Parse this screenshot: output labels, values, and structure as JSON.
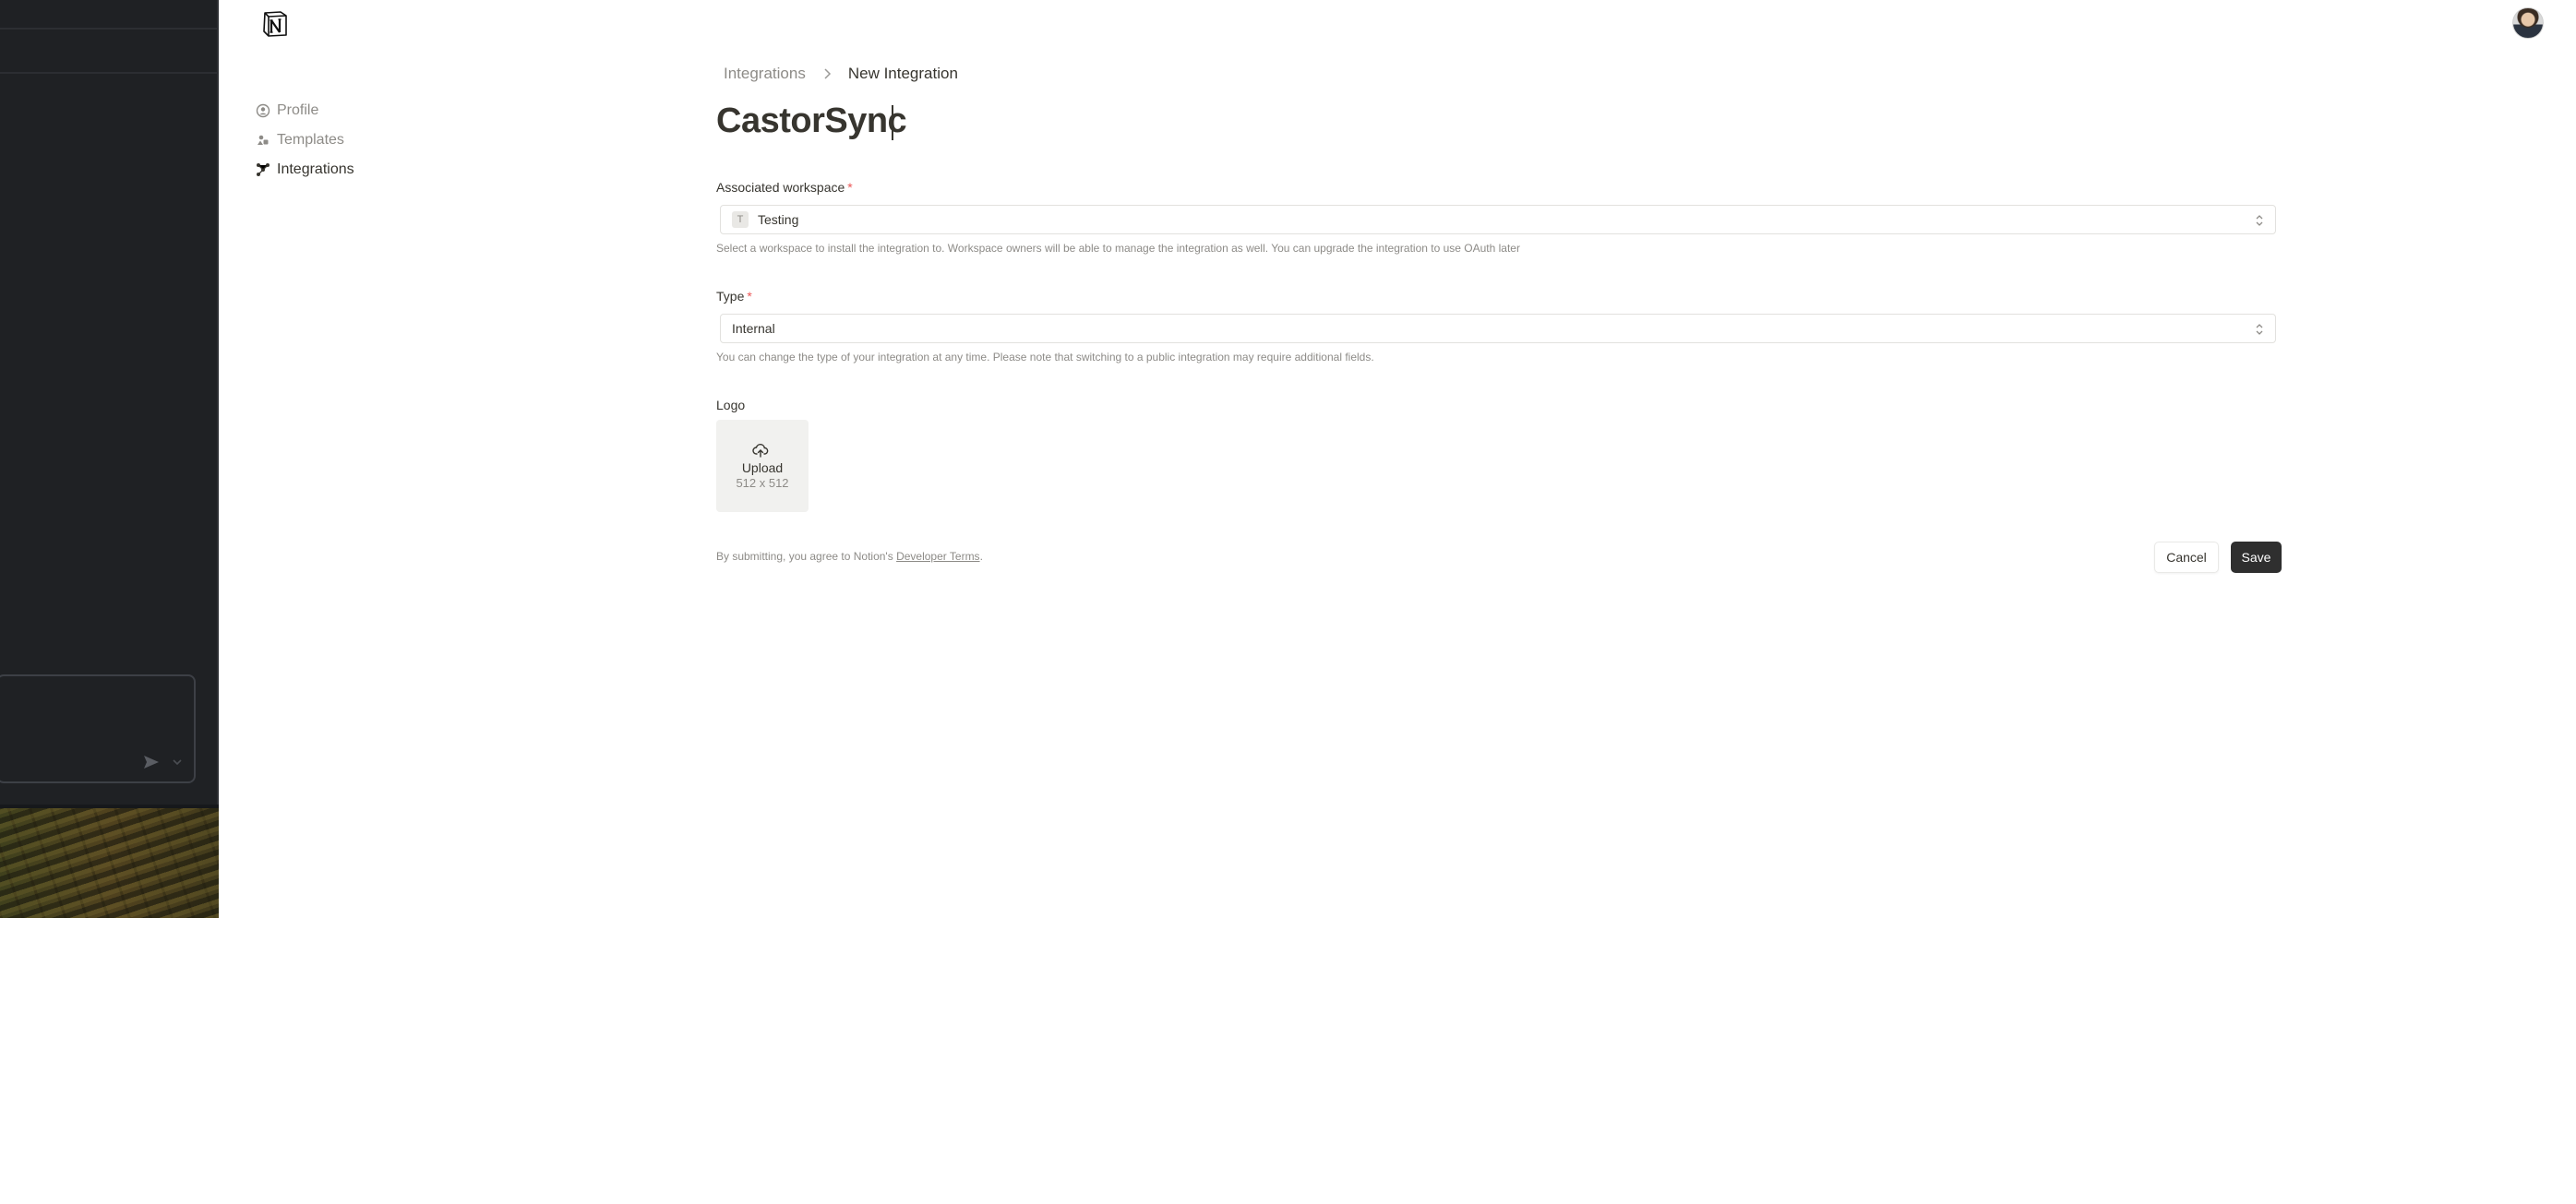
{
  "sidebar_nav": {
    "items": [
      {
        "label": "Profile",
        "icon": "profile-icon",
        "active": false
      },
      {
        "label": "Templates",
        "icon": "templates-icon",
        "active": false
      },
      {
        "label": "Integrations",
        "icon": "integrations-icon",
        "active": true
      }
    ]
  },
  "breadcrumb": {
    "parent": "Integrations",
    "current": "New Integration"
  },
  "form": {
    "name_value": "CastorSync",
    "workspace": {
      "label": "Associated workspace",
      "required_mark": "*",
      "badge": "T",
      "value": "Testing",
      "help": "Select a workspace to install the integration to. Workspace owners will be able to manage the integration as well. You can upgrade the integration to use OAuth later"
    },
    "type": {
      "label": "Type",
      "required_mark": "*",
      "value": "Internal",
      "help": "You can change the type of your integration at any time. Please note that switching to a public integration may require additional fields."
    },
    "logo": {
      "label": "Logo",
      "upload_label": "Upload",
      "size_hint": "512 x 512"
    },
    "terms": {
      "prefix": "By submitting, you agree to Notion's",
      "link_text": "Developer Terms",
      "suffix": "."
    },
    "cancel_label": "Cancel",
    "save_label": "Save"
  },
  "colors": {
    "required": "#eb5757",
    "primary_button": "#2f2f2f",
    "muted_text": "#8d8b87",
    "dark_panel": "#1f2124"
  }
}
